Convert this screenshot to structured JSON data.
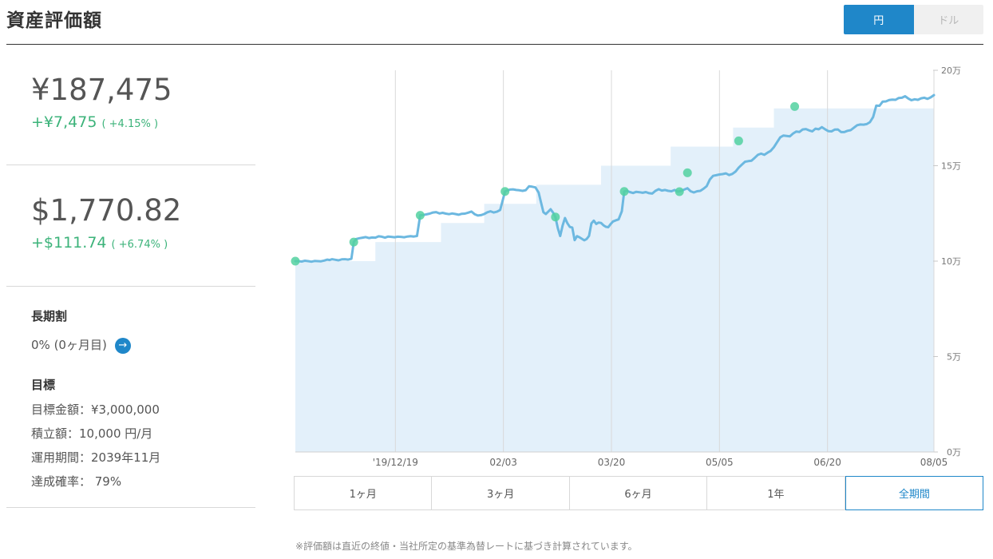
{
  "header": {
    "title": "資産評価額",
    "currency_options": [
      {
        "label": "円",
        "active": true
      },
      {
        "label": "ドル",
        "active": false
      }
    ]
  },
  "summary": {
    "yen": {
      "value": "¥187,475",
      "change": "+¥7,475",
      "pct": "( +4.15% )"
    },
    "usd": {
      "value": "$1,770.82",
      "change": "+$111.74",
      "pct": "( +6.74% )"
    }
  },
  "long_term": {
    "label": "長期割",
    "value": "0% (0ヶ月目)"
  },
  "goal": {
    "label": "目標",
    "amount": "目標金額：¥3,000,000",
    "monthly": "積立額：10,000 円/月",
    "period": "運用期間：2039年11月",
    "probability": "達成確率： 79%"
  },
  "periods": [
    {
      "label": "1ヶ月",
      "active": false
    },
    {
      "label": "3ヶ月",
      "active": false
    },
    {
      "label": "6ヶ月",
      "active": false
    },
    {
      "label": "1年",
      "active": false
    },
    {
      "label": "全期間",
      "active": true
    }
  ],
  "footnote": "※評価額は直近の終値・当社所定の基準為替レートに基づき計算されています。",
  "colors": {
    "accent": "#1f87c9",
    "positive": "#3cb37a",
    "line": "#6cb8e0",
    "area": "#e3f0fa",
    "marker": "#52d1a0"
  },
  "chart_data": {
    "type": "line",
    "x_ticks": [
      "'19/12/19",
      "02/03",
      "03/20",
      "05/05",
      "06/20",
      "08/05"
    ],
    "y_ticks": [
      "0万",
      "5万",
      "10万",
      "15万",
      "20万"
    ],
    "ylim": [
      0,
      200000
    ],
    "series": [
      {
        "values": [
          [
            0,
            100000
          ],
          [
            3,
            100000
          ],
          [
            8,
            99800
          ],
          [
            12,
            100200
          ],
          [
            16,
            100000
          ],
          [
            20,
            99700
          ],
          [
            24,
            100100
          ],
          [
            28,
            100000
          ],
          [
            32,
            99900
          ],
          [
            36,
            100300
          ],
          [
            40,
            100800
          ],
          [
            43,
            100600
          ],
          [
            46,
            101000
          ],
          [
            50,
            100700
          ],
          [
            54,
            100400
          ],
          [
            58,
            100900
          ],
          [
            62,
            101000
          ],
          [
            66,
            100800
          ],
          [
            70,
            101200
          ],
          [
            73,
            110000
          ],
          [
            76,
            111600
          ],
          [
            80,
            112000
          ],
          [
            84,
            112300
          ],
          [
            88,
            112600
          ],
          [
            92,
            112100
          ],
          [
            96,
            112400
          ],
          [
            100,
            112300
          ],
          [
            104,
            113000
          ],
          [
            108,
            112800
          ],
          [
            112,
            112300
          ],
          [
            116,
            112900
          ],
          [
            120,
            112700
          ],
          [
            124,
            112500
          ],
          [
            128,
            112800
          ],
          [
            132,
            112700
          ],
          [
            136,
            112500
          ],
          [
            140,
            112900
          ],
          [
            144,
            113100
          ],
          [
            148,
            112900
          ],
          [
            152,
            113200
          ],
          [
            156,
            124000
          ],
          [
            160,
            124200
          ],
          [
            164,
            124500
          ],
          [
            168,
            124900
          ],
          [
            172,
            125500
          ],
          [
            176,
            125700
          ],
          [
            180,
            125000
          ],
          [
            184,
            125300
          ],
          [
            188,
            124900
          ],
          [
            192,
            124600
          ],
          [
            196,
            125000
          ],
          [
            200,
            124700
          ],
          [
            204,
            124300
          ],
          [
            208,
            124800
          ],
          [
            212,
            124900
          ],
          [
            216,
            125400
          ],
          [
            220,
            126000
          ],
          [
            224,
            124600
          ],
          [
            228,
            123900
          ],
          [
            232,
            124100
          ],
          [
            236,
            124700
          ],
          [
            240,
            125600
          ],
          [
            244,
            126100
          ],
          [
            248,
            125500
          ],
          [
            252,
            125900
          ],
          [
            256,
            126800
          ],
          [
            262,
            136500
          ],
          [
            264,
            136900
          ],
          [
            268,
            137500
          ],
          [
            272,
            137600
          ],
          [
            276,
            137300
          ],
          [
            280,
            137100
          ],
          [
            284,
            136800
          ],
          [
            288,
            137200
          ],
          [
            292,
            139200
          ],
          [
            296,
            139000
          ],
          [
            300,
            138600
          ],
          [
            304,
            135900
          ],
          [
            307,
            130700
          ],
          [
            310,
            125600
          ],
          [
            313,
            124700
          ],
          [
            316,
            125900
          ],
          [
            319,
            127200
          ],
          [
            322,
            125500
          ],
          [
            325,
            123100
          ],
          [
            328,
            117300
          ],
          [
            331,
            113200
          ],
          [
            334,
            118600
          ],
          [
            337,
            122600
          ],
          [
            340,
            119800
          ],
          [
            343,
            117900
          ],
          [
            346,
            117600
          ],
          [
            349,
            111000
          ],
          [
            352,
            113100
          ],
          [
            355,
            112500
          ],
          [
            358,
            111700
          ],
          [
            361,
            110900
          ],
          [
            364,
            111600
          ],
          [
            367,
            113200
          ],
          [
            370,
            119800
          ],
          [
            373,
            121200
          ],
          [
            376,
            119500
          ],
          [
            379,
            120200
          ],
          [
            382,
            120000
          ],
          [
            385,
            118800
          ],
          [
            388,
            118000
          ],
          [
            391,
            117800
          ],
          [
            394,
            119400
          ],
          [
            397,
            120800
          ],
          [
            400,
            121300
          ],
          [
            404,
            121900
          ],
          [
            408,
            126100
          ],
          [
            411,
            136500
          ],
          [
            414,
            136900
          ],
          [
            418,
            136200
          ],
          [
            422,
            135700
          ],
          [
            426,
            136300
          ],
          [
            430,
            136100
          ],
          [
            434,
            135800
          ],
          [
            438,
            136200
          ],
          [
            442,
            135600
          ],
          [
            446,
            135400
          ],
          [
            450,
            136800
          ],
          [
            454,
            137700
          ],
          [
            458,
            137000
          ],
          [
            462,
            137300
          ],
          [
            466,
            136800
          ],
          [
            470,
            136600
          ],
          [
            474,
            137300
          ],
          [
            478,
            136400
          ],
          [
            482,
            136800
          ],
          [
            486,
            137500
          ],
          [
            490,
            138200
          ],
          [
            494,
            136600
          ],
          [
            498,
            136000
          ],
          [
            502,
            136600
          ],
          [
            506,
            136800
          ],
          [
            510,
            137900
          ],
          [
            514,
            139300
          ],
          [
            518,
            142800
          ],
          [
            522,
            144700
          ],
          [
            526,
            145000
          ],
          [
            530,
            145400
          ],
          [
            534,
            145600
          ],
          [
            538,
            146000
          ],
          [
            542,
            145100
          ],
          [
            546,
            145700
          ],
          [
            550,
            146900
          ],
          [
            554,
            149000
          ],
          [
            558,
            150600
          ],
          [
            562,
            152100
          ],
          [
            566,
            152400
          ],
          [
            570,
            152600
          ],
          [
            574,
            154100
          ],
          [
            578,
            155700
          ],
          [
            582,
            156300
          ],
          [
            586,
            155700
          ],
          [
            590,
            156800
          ],
          [
            594,
            157800
          ],
          [
            598,
            159700
          ],
          [
            602,
            162300
          ],
          [
            606,
            164900
          ],
          [
            610,
            165800
          ],
          [
            614,
            165600
          ],
          [
            618,
            165400
          ],
          [
            622,
            166900
          ],
          [
            626,
            167900
          ],
          [
            630,
            167700
          ],
          [
            634,
            169000
          ],
          [
            638,
            169200
          ],
          [
            642,
            168500
          ],
          [
            646,
            168000
          ],
          [
            650,
            169400
          ],
          [
            654,
            169100
          ],
          [
            658,
            170200
          ],
          [
            662,
            169100
          ],
          [
            666,
            168100
          ],
          [
            670,
            168000
          ],
          [
            674,
            168900
          ],
          [
            678,
            169000
          ],
          [
            682,
            167600
          ],
          [
            686,
            167600
          ],
          [
            690,
            168300
          ],
          [
            694,
            168600
          ],
          [
            698,
            169900
          ],
          [
            702,
            171200
          ],
          [
            706,
            171600
          ],
          [
            710,
            171500
          ],
          [
            714,
            171800
          ],
          [
            718,
            172800
          ],
          [
            722,
            175500
          ],
          [
            726,
            181500
          ],
          [
            730,
            181400
          ],
          [
            734,
            183600
          ],
          [
            738,
            183700
          ],
          [
            742,
            184400
          ],
          [
            746,
            184600
          ],
          [
            750,
            184500
          ],
          [
            754,
            185500
          ],
          [
            758,
            185600
          ],
          [
            762,
            186400
          ],
          [
            766,
            185200
          ],
          [
            770,
            184300
          ],
          [
            774,
            184800
          ],
          [
            778,
            184500
          ],
          [
            782,
            185300
          ],
          [
            786,
            185600
          ],
          [
            790,
            185000
          ],
          [
            794,
            185800
          ],
          [
            798,
            187000
          ]
        ]
      }
    ],
    "deposits": [
      [
        0,
        100000
      ],
      [
        100,
        110000
      ],
      [
        182,
        120000
      ],
      [
        236,
        130000
      ],
      [
        301,
        140000
      ],
      [
        382,
        150000
      ],
      [
        469,
        160000
      ],
      [
        547,
        170000
      ],
      [
        598,
        180000
      ],
      [
        798,
        180000
      ]
    ],
    "markers": [
      [
        0,
        100000
      ],
      [
        73,
        110000
      ],
      [
        156,
        124000
      ],
      [
        262,
        136500
      ],
      [
        325,
        123100
      ],
      [
        411,
        136500
      ],
      [
        480,
        136400
      ],
      [
        490,
        146300
      ],
      [
        554,
        163000
      ],
      [
        624,
        181000
      ]
    ],
    "grid": true
  }
}
